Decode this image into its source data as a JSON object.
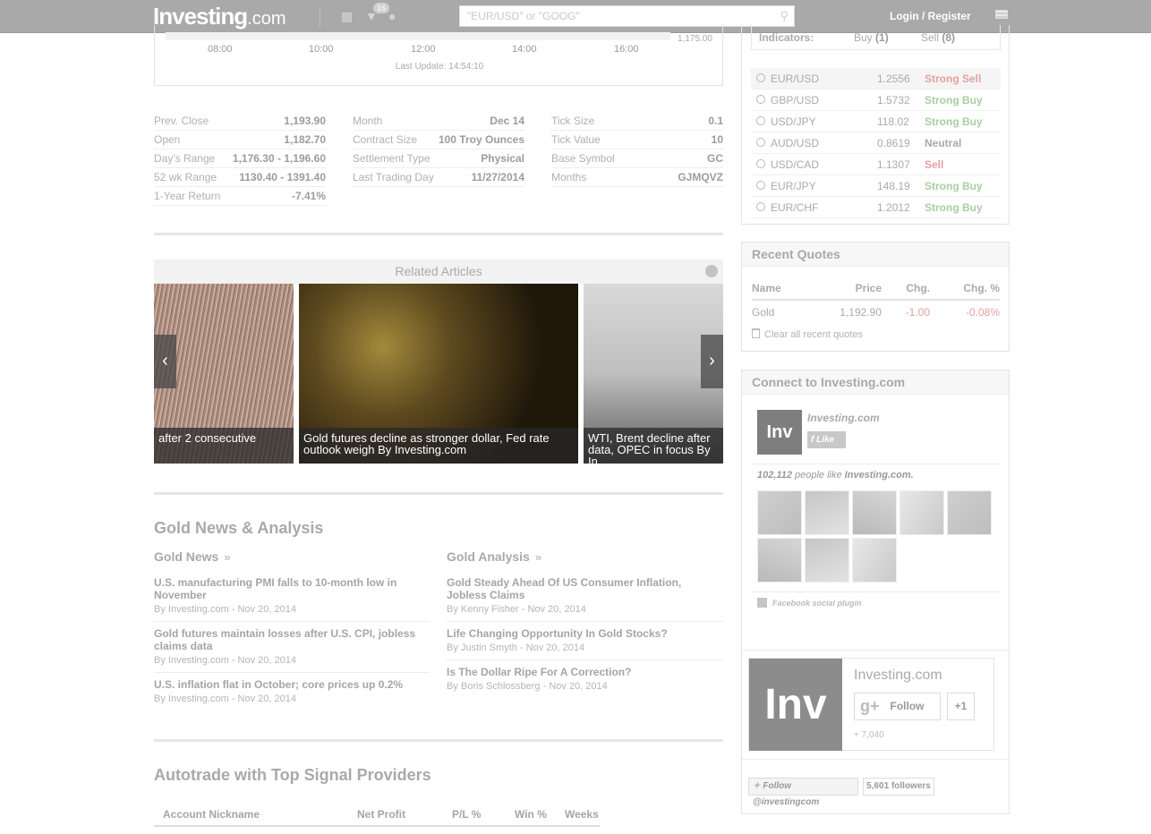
{
  "topbar": {
    "logo_main": "Investing",
    "logo_suffix": ".com",
    "notif_count": "16",
    "search_placeholder": "\"EUR/USD\" or \"GOOG\"",
    "login_label": "Login / Register"
  },
  "chart": {
    "ticks": [
      "08:00",
      "10:00",
      "12:00",
      "14:00",
      "16:00"
    ],
    "y_label": "1,175.00",
    "last_update": "Last Update: 14:54:10"
  },
  "stats": {
    "col1": [
      {
        "label": "Prev. Close",
        "value": "1,193.90"
      },
      {
        "label": "Open",
        "value": "1,182.70"
      },
      {
        "label": "Day's Range",
        "value": "1,176.30 - 1,196.60"
      },
      {
        "label": "52 wk Range",
        "value": "1130.40 - 1391.40"
      },
      {
        "label": "1-Year Return",
        "value": "-7.41%"
      }
    ],
    "col2": [
      {
        "label": "Month",
        "value": "Dec 14"
      },
      {
        "label": "Contract Size",
        "value": "100 Troy Ounces"
      },
      {
        "label": "Settlement Type",
        "value": "Physical"
      },
      {
        "label": "Last Trading Day",
        "value": "11/27/2014"
      }
    ],
    "col3": [
      {
        "label": "Tick Size",
        "value": "0.1"
      },
      {
        "label": "Tick Value",
        "value": "10"
      },
      {
        "label": "Base Symbol",
        "value": "GC"
      },
      {
        "label": "Months",
        "value": "GJMQVZ"
      }
    ]
  },
  "related": {
    "title": "Related Articles",
    "slides": [
      {
        "caption": "after 2 consecutive"
      },
      {
        "caption": "Gold futures decline as stronger dollar, Fed rate outlook weigh By Investing.com"
      },
      {
        "caption": "WTI, Brent decline after data, OPEC in focus By In"
      }
    ]
  },
  "news_section": {
    "title": "Gold News & Analysis",
    "news_title": "Gold News",
    "analysis_title": "Gold Analysis",
    "raquo": "»",
    "news": [
      {
        "title": "U.S. manufacturing PMI falls to 10-month low in November",
        "meta": "By Investing.com - Nov 20, 2014"
      },
      {
        "title": "Gold futures maintain losses after U.S. CPI, jobless claims data",
        "meta": "By Investing.com - Nov 20, 2014"
      },
      {
        "title": "U.S. inflation flat in October; core prices up 0.2%",
        "meta": "By Investing.com - Nov 20, 2014"
      }
    ],
    "analysis": [
      {
        "title": "Gold Steady Ahead Of US Consumer Inflation, Jobless Claims",
        "meta": "By Kenny Fisher - Nov 20, 2014"
      },
      {
        "title": "Life Changing Opportunity In Gold Stocks?",
        "meta": "By Justin Smyth - Nov 20, 2014"
      },
      {
        "title": "Is The Dollar Ripe For A Correction?",
        "meta": "By Boris Schlossberg - Nov 20, 2014"
      }
    ]
  },
  "autotrade": {
    "title": "Autotrade with Top Signal Providers",
    "columns": [
      "Account Nickname",
      "Net Profit",
      "P/L %",
      "Win %",
      "Weeks"
    ]
  },
  "indicators": {
    "label": "Indicators:",
    "buy": "Buy",
    "buy_count": "(1)",
    "sell": "Sell",
    "sell_count": "(8)",
    "rows": [
      {
        "symbol": "EUR/USD",
        "price": "1.2556",
        "signal": "Strong Sell",
        "color": "#e5a0a0"
      },
      {
        "symbol": "GBP/USD",
        "price": "1.5732",
        "signal": "Strong Buy",
        "color": "#a8cfa0"
      },
      {
        "symbol": "USD/JPY",
        "price": "118.02",
        "signal": "Strong Buy",
        "color": "#a8cfa0"
      },
      {
        "symbol": "AUD/USD",
        "price": "0.8619",
        "signal": "Neutral",
        "color": "#aaaaaa"
      },
      {
        "symbol": "USD/CAD",
        "price": "1.1307",
        "signal": "Sell",
        "color": "#e5a0a0"
      },
      {
        "symbol": "EUR/JPY",
        "price": "148.19",
        "signal": "Strong Buy",
        "color": "#a8cfa0"
      },
      {
        "symbol": "EUR/CHF",
        "price": "1.2012",
        "signal": "Strong Buy",
        "color": "#a8cfa0"
      }
    ]
  },
  "recent_quotes": {
    "title": "Recent Quotes",
    "headers": [
      "Name",
      "Price",
      "Chg.",
      "Chg. %"
    ],
    "rows": [
      {
        "name": "Gold",
        "price": "1,192.90",
        "chg": "-1.00",
        "chgp": "-0.08%"
      }
    ],
    "clear_label": "Clear all recent quotes",
    "neg_color": "#e5a0a0"
  },
  "connect": {
    "title": "Connect to Investing.com",
    "page_name": "Investing.com",
    "like_label": "Like",
    "likes_count": "102,112",
    "likes_text": "people like",
    "likes_page": "Investing.com.",
    "plugin_label": "Facebook social plugin",
    "logo_text": "Inv",
    "gplus_name": "Investing.com",
    "follow_label": "Follow",
    "plus_one": "+1",
    "gplus_count": "+ 7,040",
    "twitter_follow": "Follow @investingcom",
    "twitter_followers": "5,601 followers"
  }
}
